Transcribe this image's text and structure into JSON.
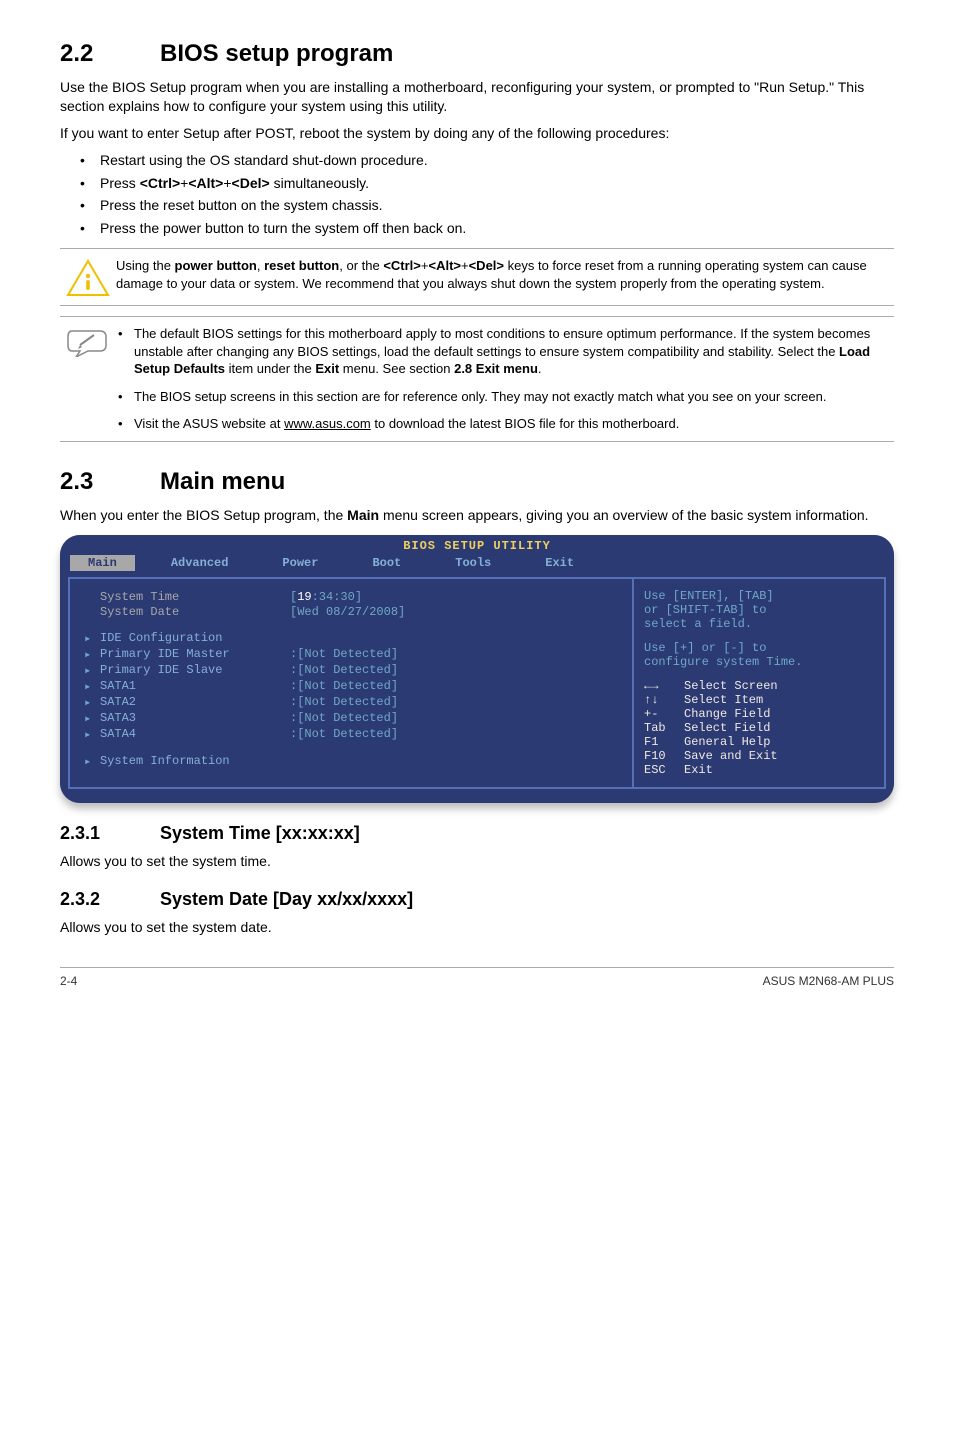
{
  "s22": {
    "num": "2.2",
    "title": "BIOS setup program",
    "p1": "Use the BIOS Setup program when you are installing a motherboard, reconfiguring your system, or prompted to \"Run Setup.\" This section explains how to configure your system using this utility.",
    "p2": "If you want to enter Setup after POST, reboot the system by doing any of the following procedures:",
    "b1": "Restart using the OS standard shut-down procedure.",
    "b2a": "Press ",
    "b2b": "<Ctrl>",
    "b2c": "+",
    "b2d": "<Alt>",
    "b2e": "+",
    "b2f": "<Del>",
    "b2g": " simultaneously.",
    "b3": "Press the reset button on the system chassis.",
    "b4": "Press the power button to turn the system off then back on."
  },
  "warn": {
    "t1": "Using the ",
    "t2": "power button",
    "t3": ", ",
    "t4": "reset button",
    "t5": ", or the ",
    "t6": "<Ctrl>",
    "t7": "+",
    "t8": "<Alt>",
    "t9": "+",
    "t10": "<Del>",
    "t11": " keys to force reset from a running operating system can cause damage to your data or system. We recommend that you always shut down the system properly from the operating system."
  },
  "note": {
    "n1a": "The default BIOS settings for this motherboard apply to most conditions to ensure optimum performance. If the system becomes unstable after changing any BIOS settings, load the default settings to ensure system compatibility and stability. Select the ",
    "n1b": "Load Setup Defaults",
    "n1c": " item under the ",
    "n1d": "Exit",
    "n1e": " menu. See section ",
    "n1f": "2.8 Exit menu",
    "n1g": ".",
    "n2": "The BIOS setup screens in this section are for reference only. They may not exactly match what you see on your screen.",
    "n3a": "Visit the ASUS website at ",
    "n3b": "www.asus.com",
    "n3c": " to download the latest BIOS file for this motherboard."
  },
  "s23": {
    "num": "2.3",
    "title": "Main menu",
    "p1a": "When you enter the BIOS Setup program, the ",
    "p1b": "Main",
    "p1c": " menu screen appears, giving you an overview of the basic system information."
  },
  "bios": {
    "title": "BIOS SETUP UTILITY",
    "tabs": [
      "Main",
      "Advanced",
      "Power",
      "Boot",
      "Tools",
      "Exit"
    ],
    "left": {
      "systime_l": "System Time",
      "systime_v1": "[",
      "systime_v2": "19",
      "systime_v3": ":34:30]",
      "sysdate_l": "System Date",
      "sysdate_v": "[Wed 08/27/2008]",
      "idecfg": "IDE Configuration",
      "pim_l": "Primary IDE Master",
      "pis_l": "Primary IDE Slave",
      "s1": "SATA1",
      "s2": "SATA2",
      "s3": "SATA3",
      "s4": "SATA4",
      "nd": ":[Not Detected]",
      "sysinfo": "System Information"
    },
    "right": {
      "h1": "Use [ENTER], [TAB]",
      "h2": "or [SHIFT-TAB] to",
      "h3": "select a field.",
      "h4": "Use [+] or [-] to",
      "h5": "configure system Time.",
      "k1s": "←→",
      "k1t": "Select Screen",
      "k2s": "↑↓",
      "k2t": "Select Item",
      "k3s": "+-",
      "k3t": "Change Field",
      "k4s": "Tab",
      "k4t": "Select Field",
      "k5s": "F1",
      "k5t": "General Help",
      "k6s": "F10",
      "k6t": "Save and Exit",
      "k7s": "ESC",
      "k7t": "Exit"
    }
  },
  "s231": {
    "num": "2.3.1",
    "title": "System Time [xx:xx:xx]",
    "p": "Allows you to set the system time."
  },
  "s232": {
    "num": "2.3.2",
    "title": "System Date [Day xx/xx/xxxx]",
    "p": "Allows you to set the system date."
  },
  "footer": {
    "left": "2-4",
    "right": "ASUS M2N68-AM PLUS"
  }
}
